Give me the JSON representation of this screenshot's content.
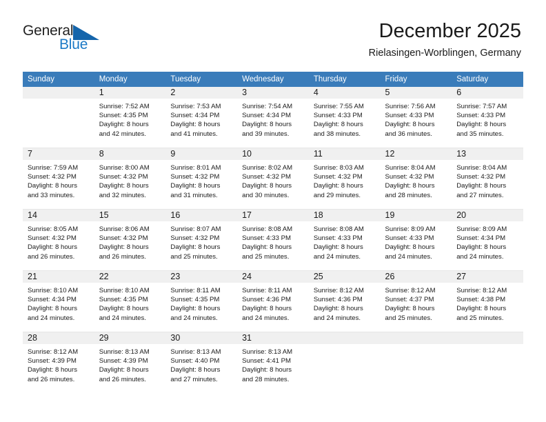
{
  "logo": {
    "word_one": "General",
    "word_two": "Blue",
    "triangle_color": "#1565ab",
    "blue_text_color": "#1b79c6"
  },
  "header": {
    "title": "December 2025",
    "subtitle": "Rielasingen-Worblingen, Germany"
  },
  "theme": {
    "header_row_bg": "#3a7cba",
    "header_row_text": "#ffffff",
    "daynum_strip_bg": "#f0f0f0",
    "row_divider": "#e6e6e6"
  },
  "weekday_headers": [
    "Sunday",
    "Monday",
    "Tuesday",
    "Wednesday",
    "Thursday",
    "Friday",
    "Saturday"
  ],
  "weeks": [
    [
      {
        "day": "",
        "lines": []
      },
      {
        "day": "1",
        "lines": [
          "Sunrise: 7:52 AM",
          "Sunset: 4:35 PM",
          "Daylight: 8 hours",
          "and 42 minutes."
        ]
      },
      {
        "day": "2",
        "lines": [
          "Sunrise: 7:53 AM",
          "Sunset: 4:34 PM",
          "Daylight: 8 hours",
          "and 41 minutes."
        ]
      },
      {
        "day": "3",
        "lines": [
          "Sunrise: 7:54 AM",
          "Sunset: 4:34 PM",
          "Daylight: 8 hours",
          "and 39 minutes."
        ]
      },
      {
        "day": "4",
        "lines": [
          "Sunrise: 7:55 AM",
          "Sunset: 4:33 PM",
          "Daylight: 8 hours",
          "and 38 minutes."
        ]
      },
      {
        "day": "5",
        "lines": [
          "Sunrise: 7:56 AM",
          "Sunset: 4:33 PM",
          "Daylight: 8 hours",
          "and 36 minutes."
        ]
      },
      {
        "day": "6",
        "lines": [
          "Sunrise: 7:57 AM",
          "Sunset: 4:33 PM",
          "Daylight: 8 hours",
          "and 35 minutes."
        ]
      }
    ],
    [
      {
        "day": "7",
        "lines": [
          "Sunrise: 7:59 AM",
          "Sunset: 4:32 PM",
          "Daylight: 8 hours",
          "and 33 minutes."
        ]
      },
      {
        "day": "8",
        "lines": [
          "Sunrise: 8:00 AM",
          "Sunset: 4:32 PM",
          "Daylight: 8 hours",
          "and 32 minutes."
        ]
      },
      {
        "day": "9",
        "lines": [
          "Sunrise: 8:01 AM",
          "Sunset: 4:32 PM",
          "Daylight: 8 hours",
          "and 31 minutes."
        ]
      },
      {
        "day": "10",
        "lines": [
          "Sunrise: 8:02 AM",
          "Sunset: 4:32 PM",
          "Daylight: 8 hours",
          "and 30 minutes."
        ]
      },
      {
        "day": "11",
        "lines": [
          "Sunrise: 8:03 AM",
          "Sunset: 4:32 PM",
          "Daylight: 8 hours",
          "and 29 minutes."
        ]
      },
      {
        "day": "12",
        "lines": [
          "Sunrise: 8:04 AM",
          "Sunset: 4:32 PM",
          "Daylight: 8 hours",
          "and 28 minutes."
        ]
      },
      {
        "day": "13",
        "lines": [
          "Sunrise: 8:04 AM",
          "Sunset: 4:32 PM",
          "Daylight: 8 hours",
          "and 27 minutes."
        ]
      }
    ],
    [
      {
        "day": "14",
        "lines": [
          "Sunrise: 8:05 AM",
          "Sunset: 4:32 PM",
          "Daylight: 8 hours",
          "and 26 minutes."
        ]
      },
      {
        "day": "15",
        "lines": [
          "Sunrise: 8:06 AM",
          "Sunset: 4:32 PM",
          "Daylight: 8 hours",
          "and 26 minutes."
        ]
      },
      {
        "day": "16",
        "lines": [
          "Sunrise: 8:07 AM",
          "Sunset: 4:32 PM",
          "Daylight: 8 hours",
          "and 25 minutes."
        ]
      },
      {
        "day": "17",
        "lines": [
          "Sunrise: 8:08 AM",
          "Sunset: 4:33 PM",
          "Daylight: 8 hours",
          "and 25 minutes."
        ]
      },
      {
        "day": "18",
        "lines": [
          "Sunrise: 8:08 AM",
          "Sunset: 4:33 PM",
          "Daylight: 8 hours",
          "and 24 minutes."
        ]
      },
      {
        "day": "19",
        "lines": [
          "Sunrise: 8:09 AM",
          "Sunset: 4:33 PM",
          "Daylight: 8 hours",
          "and 24 minutes."
        ]
      },
      {
        "day": "20",
        "lines": [
          "Sunrise: 8:09 AM",
          "Sunset: 4:34 PM",
          "Daylight: 8 hours",
          "and 24 minutes."
        ]
      }
    ],
    [
      {
        "day": "21",
        "lines": [
          "Sunrise: 8:10 AM",
          "Sunset: 4:34 PM",
          "Daylight: 8 hours",
          "and 24 minutes."
        ]
      },
      {
        "day": "22",
        "lines": [
          "Sunrise: 8:10 AM",
          "Sunset: 4:35 PM",
          "Daylight: 8 hours",
          "and 24 minutes."
        ]
      },
      {
        "day": "23",
        "lines": [
          "Sunrise: 8:11 AM",
          "Sunset: 4:35 PM",
          "Daylight: 8 hours",
          "and 24 minutes."
        ]
      },
      {
        "day": "24",
        "lines": [
          "Sunrise: 8:11 AM",
          "Sunset: 4:36 PM",
          "Daylight: 8 hours",
          "and 24 minutes."
        ]
      },
      {
        "day": "25",
        "lines": [
          "Sunrise: 8:12 AM",
          "Sunset: 4:36 PM",
          "Daylight: 8 hours",
          "and 24 minutes."
        ]
      },
      {
        "day": "26",
        "lines": [
          "Sunrise: 8:12 AM",
          "Sunset: 4:37 PM",
          "Daylight: 8 hours",
          "and 25 minutes."
        ]
      },
      {
        "day": "27",
        "lines": [
          "Sunrise: 8:12 AM",
          "Sunset: 4:38 PM",
          "Daylight: 8 hours",
          "and 25 minutes."
        ]
      }
    ],
    [
      {
        "day": "28",
        "lines": [
          "Sunrise: 8:12 AM",
          "Sunset: 4:39 PM",
          "Daylight: 8 hours",
          "and 26 minutes."
        ]
      },
      {
        "day": "29",
        "lines": [
          "Sunrise: 8:13 AM",
          "Sunset: 4:39 PM",
          "Daylight: 8 hours",
          "and 26 minutes."
        ]
      },
      {
        "day": "30",
        "lines": [
          "Sunrise: 8:13 AM",
          "Sunset: 4:40 PM",
          "Daylight: 8 hours",
          "and 27 minutes."
        ]
      },
      {
        "day": "31",
        "lines": [
          "Sunrise: 8:13 AM",
          "Sunset: 4:41 PM",
          "Daylight: 8 hours",
          "and 28 minutes."
        ]
      },
      {
        "day": "",
        "lines": []
      },
      {
        "day": "",
        "lines": []
      },
      {
        "day": "",
        "lines": []
      }
    ]
  ]
}
